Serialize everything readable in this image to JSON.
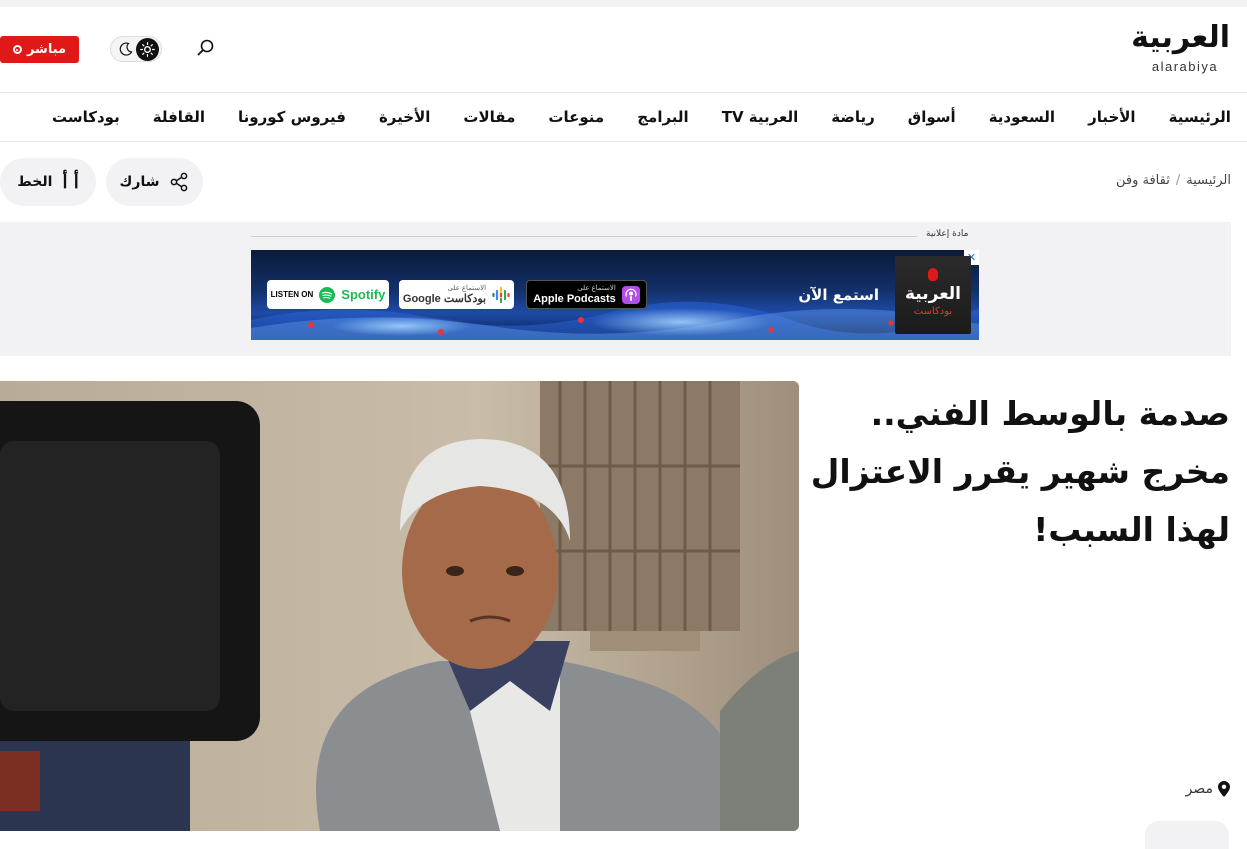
{
  "header": {
    "logo_ar": "العربية",
    "logo_en": "alarabiya",
    "live_label": "مباشر"
  },
  "nav": {
    "items": [
      "الرئيسية",
      "الأخبار",
      "السعودية",
      "أسواق",
      "رياضة",
      "العربية TV",
      "البرامج",
      "منوعات",
      "مقالات",
      "الأخيرة",
      "فيروس كورونا",
      "القافلة",
      "بودكاست"
    ]
  },
  "breadcrumb": {
    "home": "الرئيسية",
    "separator": "/",
    "section": "ثقافة وفن"
  },
  "toolbar": {
    "share_label": "شارك",
    "font_label": "الخط",
    "font_glyph": "أ أ"
  },
  "ad": {
    "label": "مادة إعلانية",
    "close": "✕",
    "logo_ar": "العربية",
    "logo_sub": "بودكاست",
    "listen_now": "استمع الآن",
    "apple_small": "الاستماع على",
    "apple_big": "Apple Podcasts",
    "google_small": "الاستماع على",
    "google_big": "Google بودكاست",
    "spotify_small": "LISTEN ON",
    "spotify_big": "Spotify"
  },
  "article": {
    "headline": "صدمة بالوسط الفني.. مخرج شهير يقرر الاعتزال لهذا السبب!",
    "location": "مصر"
  },
  "colors": {
    "live_red": "#e01818",
    "pill_bg": "#f2f2f4",
    "text": "#111111"
  }
}
